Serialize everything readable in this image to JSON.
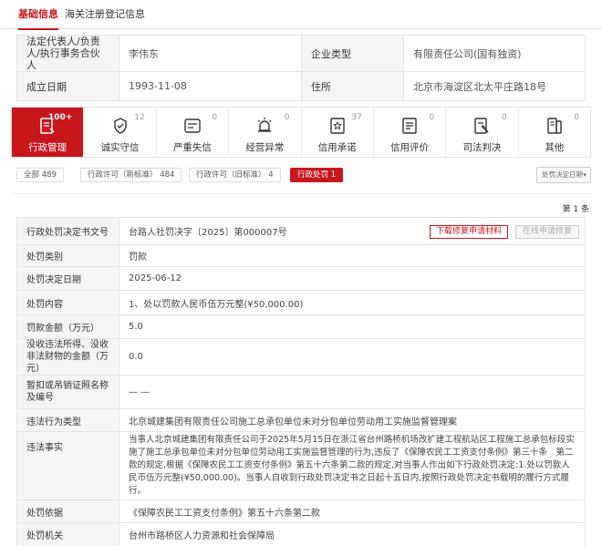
{
  "tabs": [
    "基础信息",
    "海关注册登记信息"
  ],
  "basic_info": {
    "rows": [
      {
        "label1": "法定代表人/负责人/执行事务合伙人",
        "value1": "李伟东",
        "label2": "企业类型",
        "value2": "有限责任公司(国有独资)"
      },
      {
        "label1": "成立日期",
        "value1": "1993-11-08",
        "label2": "住所",
        "value2": "北京市海淀区北太平庄路18号"
      }
    ]
  },
  "categories": [
    {
      "label": "行政管理",
      "count": "100+",
      "icon": "admin-management-icon",
      "active": true
    },
    {
      "label": "诚实守信",
      "count": "12",
      "icon": "honesty-icon",
      "active": false
    },
    {
      "label": "严重失信",
      "count": "0",
      "icon": "serious-dishonesty-icon",
      "active": false
    },
    {
      "label": "经营异常",
      "count": "0",
      "icon": "abnormal-operation-icon",
      "active": false
    },
    {
      "label": "信用承诺",
      "count": "37",
      "icon": "credit-commitment-icon",
      "active": false
    },
    {
      "label": "信用评价",
      "count": "0",
      "icon": "credit-evaluation-icon",
      "active": false
    },
    {
      "label": "司法判决",
      "count": "0",
      "icon": "judicial-judgment-icon",
      "active": false
    },
    {
      "label": "其他",
      "count": "0",
      "icon": "other-icon",
      "active": false
    }
  ],
  "filters": {
    "chips": [
      "全部 489",
      "行政许可（新标准） 484",
      "行政许可（旧标准） 4",
      "行政处罚 1"
    ],
    "sort_label": "处罚决定日期",
    "sort_arrow": "▾"
  },
  "page_count": "第 1 条",
  "detail": {
    "download_button": "下载修复申请材料",
    "online_button": "在线申请修复",
    "rows": [
      {
        "label": "行政处罚决定书文号",
        "value": "台路人社罚决字〔2025〕第000007号"
      },
      {
        "label": "处罚类别",
        "value": "罚款"
      },
      {
        "label": "处罚决定日期",
        "value": "2025-06-12"
      },
      {
        "label": "处罚内容",
        "value": "1、处以罚款人民币伍万元整(¥50,000.00)"
      },
      {
        "label": "罚款金额（万元）",
        "value": "5.0"
      },
      {
        "label": "没收违法所得、没收非法财物的金额（万元）",
        "value": "0.0"
      },
      {
        "label": "暂扣或吊销证照名称及编号",
        "value": "— —"
      },
      {
        "label": "违法行为类型",
        "value": "北京城建集团有限责任公司施工总承包单位未对分包单位劳动用工实施监督管理案"
      },
      {
        "label": "违法事实",
        "value": "当事人北京城建集团有限责任公司于2025年5月15日在浙江省台州路桥机场改扩建工程航站区工程施工总承包标段实施了施工总承包单位未对分包单位劳动用工实施监督管理的行为,违反了《保障农民工工资支付条例》第三十条　第二款的规定,根据《保障农民工工资支付条例》第五十六条第二款的规定,对当事人作出如下行政处罚决定:1.处以罚款人民币伍万元整(¥50,000.00)。当事人自收到行政处罚决定书之日起十五日内,按照行政处罚决定书载明的履行方式履行。"
      },
      {
        "label": "处罚依据",
        "value": "《保障农民工工资支付条例》第五十六条第二款"
      },
      {
        "label": "处罚机关",
        "value": "台州市路桥区人力资源和社会保障局"
      }
    ]
  },
  "colors": {
    "accent": "#c8161d"
  }
}
